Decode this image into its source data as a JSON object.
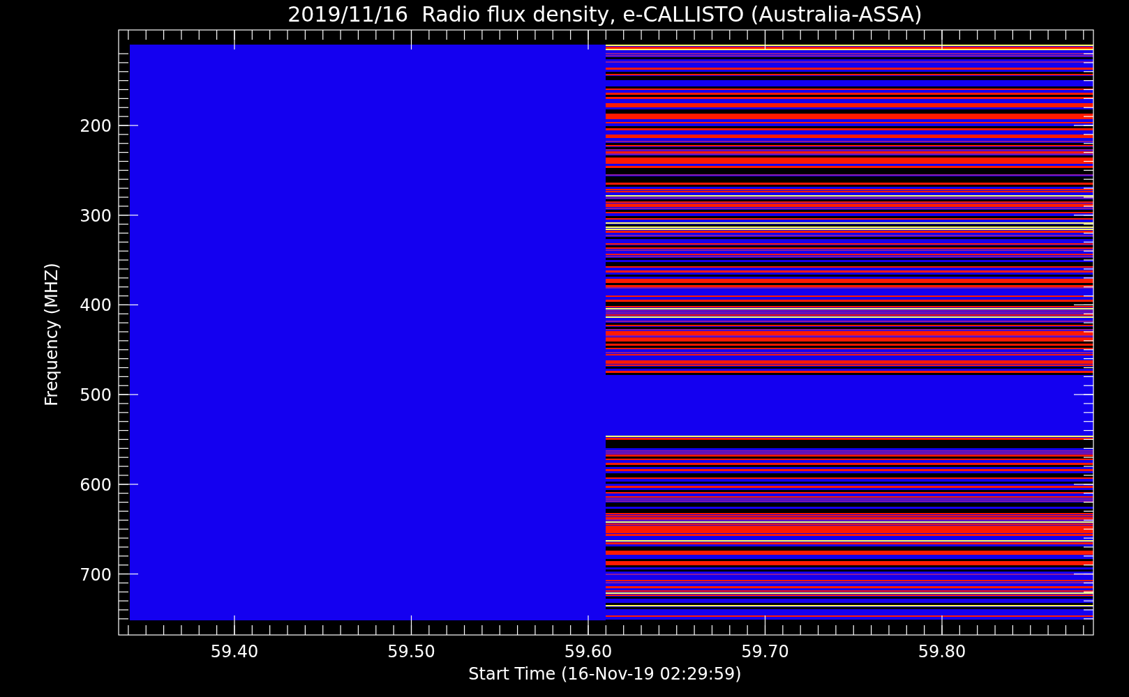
{
  "title": "2019/11/16  Radio flux density, e-CALLISTO (Australia-ASSA)",
  "y_axis": {
    "label": "Frequency (MHZ)",
    "ticks": [
      "200",
      "300",
      "400",
      "500",
      "600",
      "700"
    ]
  },
  "x_axis": {
    "label": "Start Time (16-Nov-19 02:29:59)",
    "ticks": [
      "59.40",
      "59.50",
      "59.60",
      "59.70",
      "59.80"
    ]
  }
}
